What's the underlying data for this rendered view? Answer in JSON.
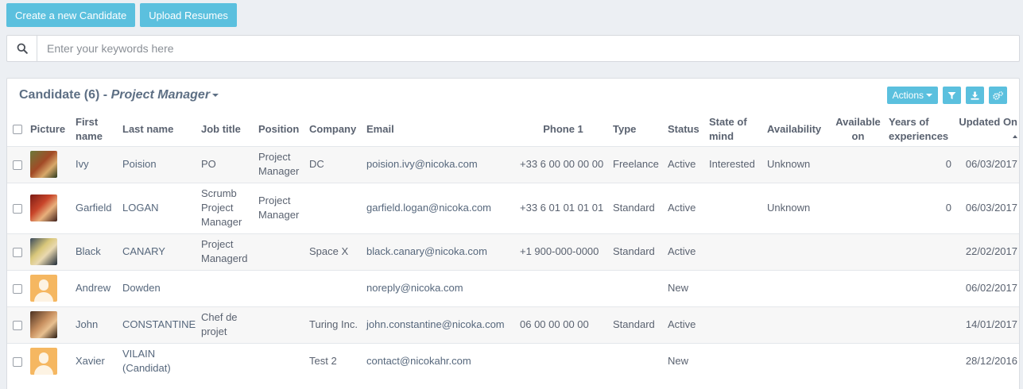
{
  "toolbar": {
    "create_label": "Create a new Candidate",
    "upload_label": "Upload Resumes"
  },
  "search": {
    "placeholder": "Enter your keywords here",
    "icon": "search-icon"
  },
  "panel": {
    "title": "Candidate (6) - ",
    "view": "Project Manager",
    "actions_label": "Actions"
  },
  "columns": {
    "picture": "Picture",
    "first_name": "First name",
    "last_name": "Last name",
    "job_title": "Job title",
    "position": "Position",
    "company": "Company",
    "email": "Email",
    "phone": "Phone 1",
    "type": "Type",
    "status": "Status",
    "state": "State of mind",
    "availability": "Availability",
    "available_on": "Available on",
    "years": "Years of experiences",
    "updated": "Updated On"
  },
  "rows": [
    {
      "avatar": "ivy",
      "first": "Ivy",
      "last": "Poision",
      "job": "PO",
      "position": "Project Manager",
      "company": "DC",
      "email": "poision.ivy@nicoka.com",
      "phone": "+33 6 00 00 00 00",
      "type": "Freelance",
      "status": "Active",
      "state": "Interested",
      "availability": "Unknown",
      "available_on": "",
      "years": "0",
      "updated": "06/03/2017"
    },
    {
      "avatar": "garfield",
      "first": "Garfield",
      "last": "LOGAN",
      "job": "Scrumb Project Manager",
      "position": "Project Manager",
      "company": "",
      "email": "garfield.logan@nicoka.com",
      "phone": "+33 6 01 01 01 01",
      "type": "Standard",
      "status": "Active",
      "state": "",
      "availability": "Unknown",
      "available_on": "",
      "years": "0",
      "updated": "06/03/2017"
    },
    {
      "avatar": "black",
      "first": "Black",
      "last": "CANARY",
      "job": "Project Managerd",
      "position": "",
      "company": "Space X",
      "email": "black.canary@nicoka.com",
      "phone": "+1 900-000-0000",
      "type": "Standard",
      "status": "Active",
      "state": "",
      "availability": "",
      "available_on": "",
      "years": "",
      "updated": "22/02/2017"
    },
    {
      "avatar": "default",
      "first": "Andrew",
      "last": "Dowden",
      "job": "",
      "position": "",
      "company": "",
      "email": "noreply@nicoka.com",
      "phone": "",
      "type": "",
      "status": "New",
      "state": "",
      "availability": "",
      "available_on": "",
      "years": "",
      "updated": "06/02/2017"
    },
    {
      "avatar": "john",
      "first": "John",
      "last": "CONSTANTINE",
      "job": "Chef de projet",
      "position": "",
      "company": "Turing Inc.",
      "email": "john.constantine@nicoka.com",
      "phone": "06 00 00 00 00",
      "type": "Standard",
      "status": "Active",
      "state": "",
      "availability": "",
      "available_on": "",
      "years": "",
      "updated": "14/01/2017"
    },
    {
      "avatar": "default",
      "first": "Xavier",
      "last": "VILAIN (Candidat)",
      "job": "",
      "position": "",
      "company": "Test 2",
      "email": "contact@nicokahr.com",
      "phone": "",
      "type": "",
      "status": "New",
      "state": "",
      "availability": "",
      "available_on": "",
      "years": "",
      "updated": "28/12/2016"
    }
  ],
  "colors": {
    "accent": "#5bc0de",
    "title": "#5d6f84",
    "background": "#eceff3"
  }
}
